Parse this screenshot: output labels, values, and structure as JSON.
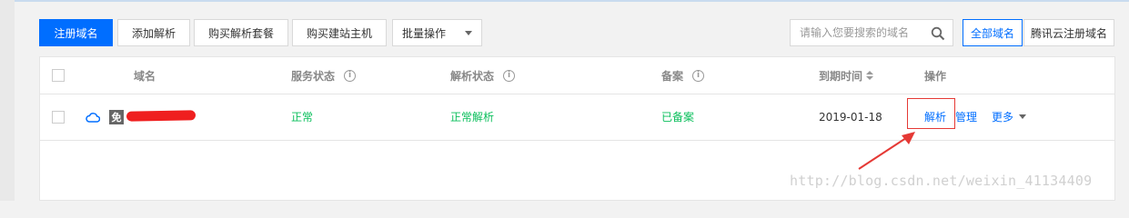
{
  "toolbar": {
    "register_domain": "注册域名",
    "add_resolution": "添加解析",
    "buy_resolution_package": "购买解析套餐",
    "buy_site_host": "购买建站主机",
    "batch_operation": "批量操作",
    "search_placeholder": "请输入您要搜索的域名",
    "tab_all_domains": "全部域名",
    "tab_tencent_registered": "腾讯云注册域名"
  },
  "table": {
    "headers": {
      "domain": "域名",
      "service_status": "服务状态",
      "resolution_status": "解析状态",
      "filing": "备案",
      "expiry": "到期时间",
      "actions": "操作"
    },
    "rows": [
      {
        "free_badge": "免",
        "service_status": "正常",
        "resolution_status": "正常解析",
        "filing_status": "已备案",
        "expiry_date": "2019-01-18",
        "action_resolve": "解析",
        "action_manage": "管理",
        "action_more": "更多"
      }
    ]
  },
  "watermark": "http://blog.csdn.net/weixin_41134409",
  "colors": {
    "primary": "#006eff",
    "success": "#0abf5b",
    "annotation": "#e53935"
  },
  "icons": {
    "search": "search-icon",
    "info": "info-icon",
    "cloud": "cloud-icon",
    "sort": "sort-icon",
    "caret": "chevron-down-icon"
  }
}
